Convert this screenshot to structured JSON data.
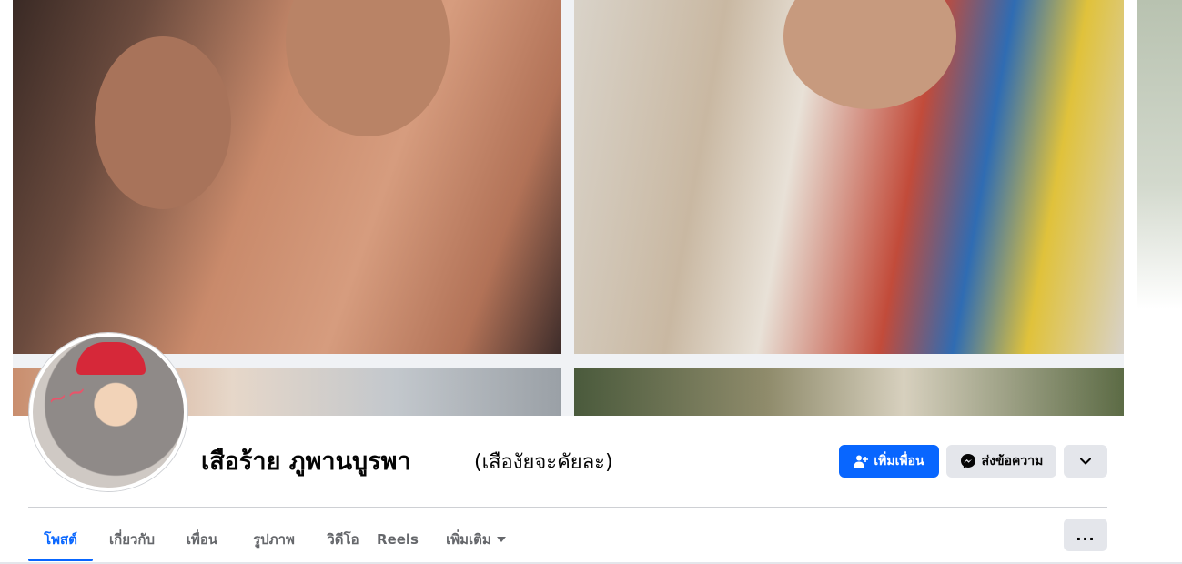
{
  "profile": {
    "name": "เสือร้าย ภูพานบูรพา",
    "alternate_name": "(เสืองัยจะคัยละ)"
  },
  "actions": {
    "add_friend_label": "เพิ่มเพื่อน",
    "message_label": "ส่งข้อความ",
    "more_icon": "chevron-down-icon"
  },
  "tabs": [
    {
      "label": "โพสต์",
      "active": true
    },
    {
      "label": "เกี่ยวกับ",
      "active": false
    },
    {
      "label": "เพื่อน",
      "active": false
    },
    {
      "label": "รูปภาพ",
      "active": false
    },
    {
      "label": "วิดีโอ",
      "active": false
    },
    {
      "label": "Reels",
      "active": false
    },
    {
      "label": "เพิ่มเติม",
      "active": false
    }
  ],
  "tabs_more_button": "...",
  "colors": {
    "accent": "#0866ff",
    "secondary_button": "#e4e6eb",
    "text_primary": "#050505",
    "text_secondary": "#65676b"
  }
}
